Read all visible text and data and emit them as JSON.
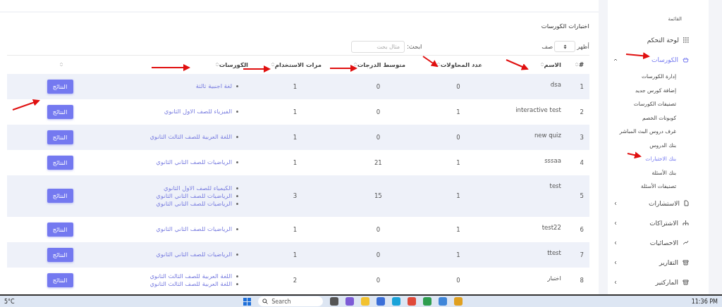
{
  "card": {
    "title": "اختبارات الكورسات",
    "length_before": "أظهر",
    "length_after": "صف",
    "search_label": "ابحث:",
    "search_placeholder": "مثال بحث"
  },
  "columns": [
    "#",
    "الاسم",
    "عدد المحاولات",
    "متوسط الدرجات",
    "مرات الاستخدام",
    "الكورسات"
  ],
  "rows": [
    {
      "num": "1",
      "name": "dsa",
      "attempts": "0",
      "average": "0",
      "uses": "1",
      "courses": [
        "لغة اجنبية ثالثة"
      ],
      "action": "النتائج"
    },
    {
      "num": "2",
      "name": "interactive test",
      "attempts": "1",
      "average": "0",
      "uses": "1",
      "courses": [
        "الفيزياء للصف الاول الثانوي"
      ],
      "action": "النتائج"
    },
    {
      "num": "3",
      "name": "new quiz",
      "attempts": "0",
      "average": "0",
      "uses": "1",
      "courses": [
        "اللغة العربية للصف الثالث الثانوي"
      ],
      "action": "النتائج"
    },
    {
      "num": "4",
      "name": "sssaa",
      "attempts": "1",
      "average": "21",
      "uses": "1",
      "courses": [
        "الرياضيات للصف الثاني الثانوي"
      ],
      "action": "النتائج"
    },
    {
      "num": "5",
      "name": "test",
      "attempts": "1",
      "average": "15",
      "uses": "3",
      "courses": [
        "الكيمياء للصف الاول الثانوي",
        "الرياضيات للصف الثاني الثانوي",
        "الرياضيات للصف الثاني الثانوي"
      ],
      "action": "النتائج"
    },
    {
      "num": "6",
      "name": "test22",
      "attempts": "1",
      "average": "0",
      "uses": "1",
      "courses": [
        "الرياضيات للصف الثاني الثانوي"
      ],
      "action": "النتائج"
    },
    {
      "num": "7",
      "name": "ttest",
      "attempts": "1",
      "average": "0",
      "uses": "1",
      "courses": [
        "الرياضيات للصف الثاني الثانوي"
      ],
      "action": "النتائج"
    },
    {
      "num": "8",
      "name": "اختبار",
      "attempts": "0",
      "average": "0",
      "uses": "2",
      "courses": [
        "اللغة العربية للصف الثالث الثانوي",
        "اللغة العربية للصف الثالث الثانوي"
      ],
      "action": "النتائج"
    }
  ],
  "sidebar": {
    "menu_label": "القائمة",
    "items": [
      {
        "kind": "link",
        "label": "لوحة التحكم",
        "selected": false
      },
      {
        "kind": "group",
        "label": "الكورسات",
        "selected": true,
        "expanded": true,
        "children": [
          {
            "label": "إدارة الكورسات",
            "selected": false
          },
          {
            "label": "إضافة كورس جديد",
            "selected": false
          },
          {
            "label": "تصنيفات الكورسات",
            "selected": false
          },
          {
            "label": "كوبونات الخصم",
            "selected": false
          },
          {
            "label": "غرف دروس البث المباشر",
            "selected": false
          },
          {
            "label": "بنك الدروس",
            "selected": false
          },
          {
            "label": "بنك الاختبارات",
            "selected": true
          },
          {
            "label": "بنك الأسئلة",
            "selected": false
          },
          {
            "label": "تصنيفات الأسئلة",
            "selected": false
          }
        ]
      },
      {
        "kind": "group",
        "label": "الاستشارات",
        "selected": false,
        "expanded": false
      },
      {
        "kind": "group",
        "label": "الاشتراكات",
        "selected": false,
        "expanded": false
      },
      {
        "kind": "group",
        "label": "الاحصائيات",
        "selected": false,
        "expanded": false
      },
      {
        "kind": "group",
        "label": "التقارير",
        "selected": false,
        "expanded": false
      },
      {
        "kind": "group",
        "label": "الماركتير",
        "selected": false,
        "expanded": false
      }
    ]
  },
  "taskbar": {
    "weather": "5°C",
    "search_placeholder": "Search",
    "time": "11:36 PM"
  }
}
